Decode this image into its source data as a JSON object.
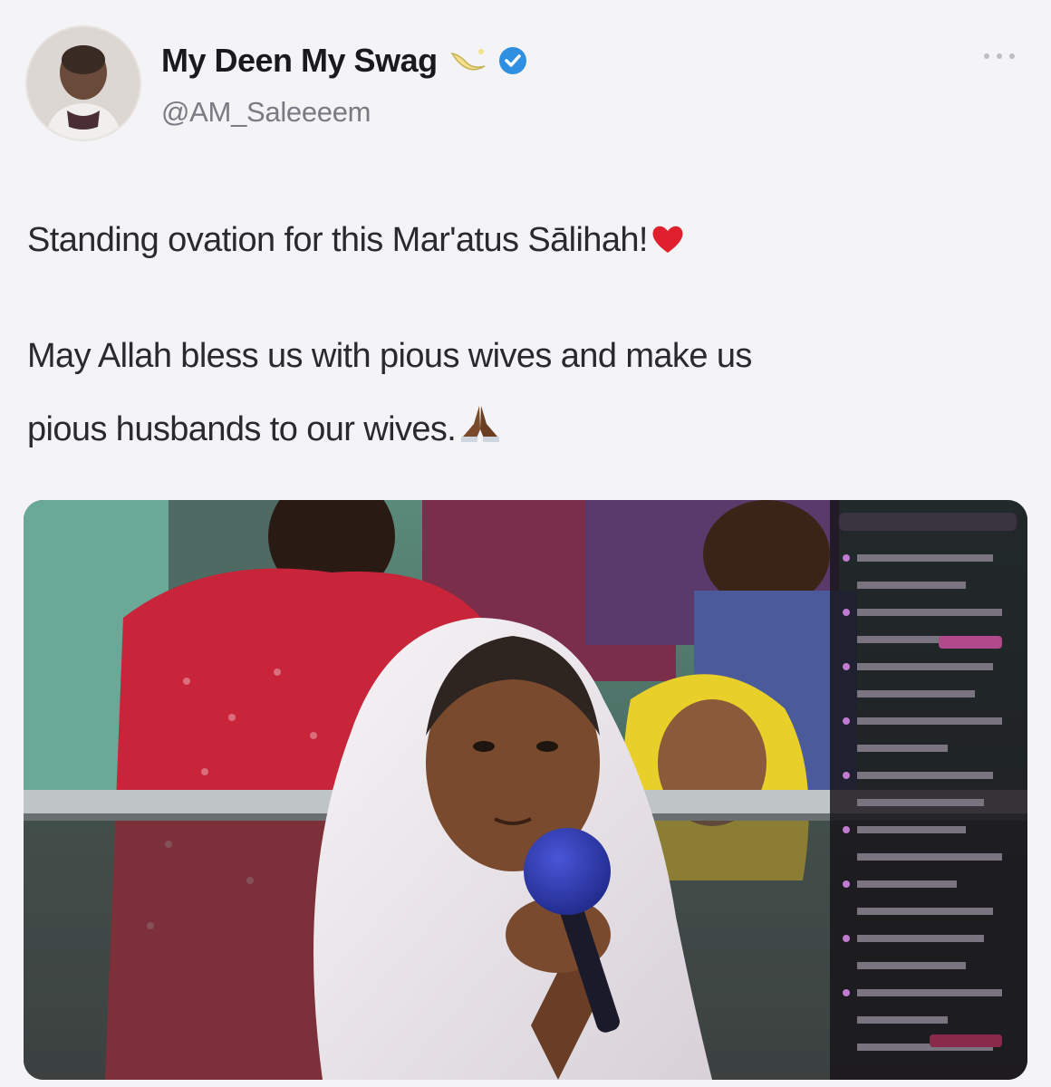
{
  "tweet": {
    "author": {
      "display_name": "My Deen My Swag",
      "handle": "@AM_Saleeeem",
      "verified": true,
      "name_emoji": "crescent-moon-icon"
    },
    "text_line1": "Standing ovation for this Mar'atus Sālihah!",
    "text_line2": "May Allah bless us with pious wives and make us",
    "text_line3": "pious husbands to our wives.",
    "line1_emoji": "red-heart-icon",
    "line3_emoji": "praying-hands-icon",
    "media": {
      "description_icon": "video-frame",
      "live_chat_panel": true
    }
  },
  "colors": {
    "background": "#f4f4f6",
    "verified_blue": "#2f8fe0",
    "heart_red": "#e0202c",
    "hijab_white": "#f0ecf0",
    "shirt_red": "#c8243a",
    "yellow_scarf": "#e9cf2a"
  }
}
